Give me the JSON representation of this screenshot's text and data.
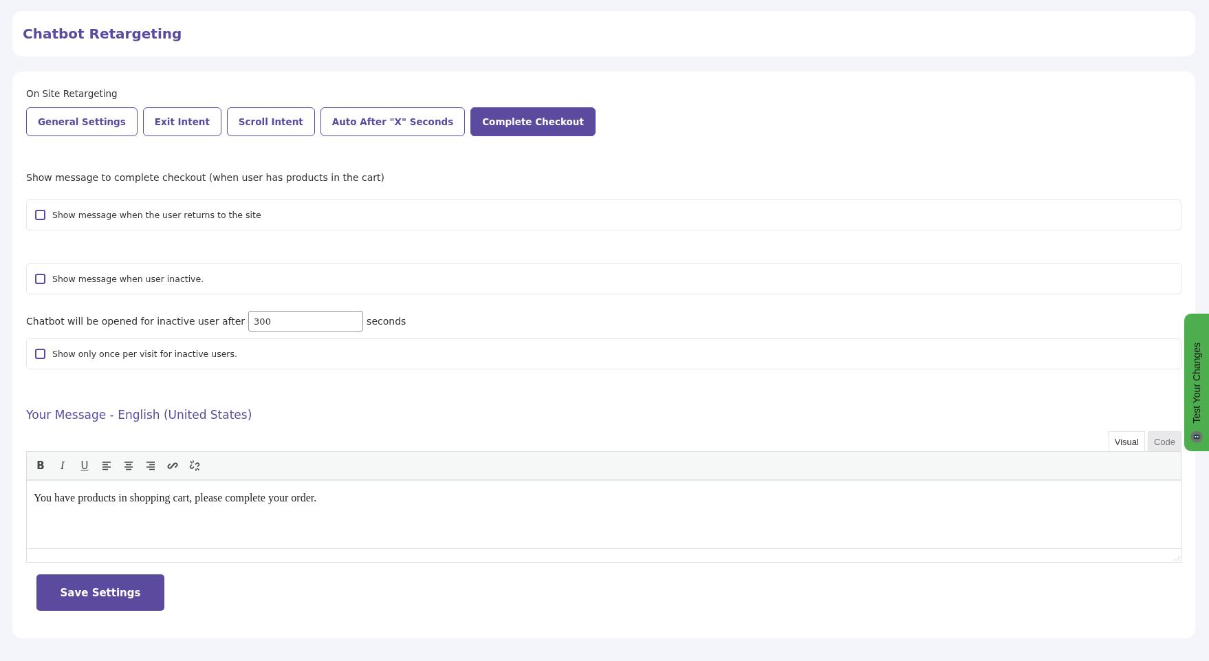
{
  "header": {
    "title": "Chatbot Retargeting"
  },
  "section_label": "On Site Retargeting",
  "tabs": [
    {
      "label": "General Settings",
      "selected": false
    },
    {
      "label": "Exit Intent",
      "selected": false
    },
    {
      "label": "Scroll Intent",
      "selected": false
    },
    {
      "label": "Auto After \"X\" Seconds",
      "selected": false
    },
    {
      "label": "Complete Checkout",
      "selected": true
    }
  ],
  "description": "Show message to complete checkout (when user has products in the cart)",
  "options": [
    {
      "kind": "checkbox",
      "label": "Show message when the user returns to the site",
      "checked": false
    },
    {
      "kind": "checkbox",
      "label": "Show message when user inactive.",
      "checked": false
    },
    {
      "kind": "number",
      "prefix": "Chatbot will be opened for inactive user after",
      "value": "300",
      "suffix": "seconds"
    },
    {
      "kind": "checkbox",
      "label": "Show only once per visit for inactive users.",
      "checked": false
    }
  ],
  "editor": {
    "heading": "Your Message - English (United States)",
    "modes": [
      {
        "label": "Visual",
        "selected": true
      },
      {
        "label": "Code",
        "selected": false
      }
    ],
    "toolbar": [
      {
        "kind": "text",
        "label": "B"
      },
      {
        "kind": "text",
        "label": "I"
      },
      {
        "kind": "text",
        "label": "U"
      },
      {
        "kind": "align-left"
      },
      {
        "kind": "align-center"
      },
      {
        "kind": "align-right"
      },
      {
        "kind": "link"
      },
      {
        "kind": "unlink"
      }
    ],
    "content": "You have products in shopping cart, please complete your order."
  },
  "save_button": "Save Settings",
  "side_tab": {
    "label": "Test Your Changes"
  }
}
